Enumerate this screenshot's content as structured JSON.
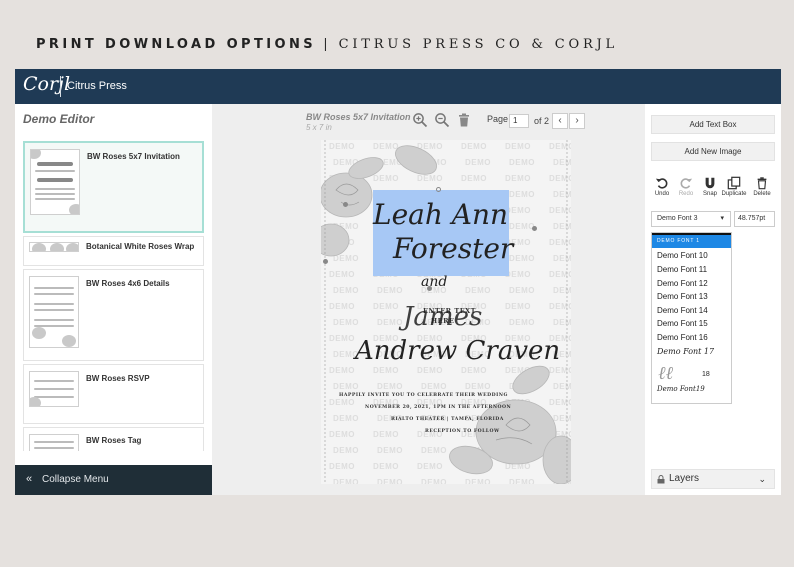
{
  "banner": {
    "part1": "PRINT DOWNLOAD OPTIONS",
    "sep": "|",
    "part2": "CITRUS PRESS CO & CORJL"
  },
  "header": {
    "logo": "Corjl",
    "brand": "Citrus Press"
  },
  "sidebar": {
    "title": "Demo Editor",
    "items": [
      {
        "label": "BW Roses 5x7 Invitation",
        "selected": true
      },
      {
        "label": "Botanical White Roses Wrap"
      },
      {
        "label": "BW Roses 4x6 Details"
      },
      {
        "label": "BW Roses RSVP"
      },
      {
        "label": "BW Roses Tag"
      }
    ],
    "collapse_icon": "double-chevron-left-icon",
    "collapse_label": "Collapse Menu"
  },
  "canvas": {
    "doc_title": "BW Roses 5x7 Invitation",
    "doc_size": "5 x 7 in",
    "page_label": "Page",
    "page_value": "1",
    "page_of": "of 2",
    "prev_icon": "chevron-left-icon",
    "next_icon": "chevron-right-icon",
    "icons": [
      "zoom-in-icon",
      "zoom-out-icon",
      "trash-icon"
    ]
  },
  "invitation": {
    "watermark": "DEMO",
    "bride_first": "Leah Ann",
    "bride_last": "Forester",
    "and": "and",
    "enter_text": "ENTER TEXT",
    "here": "HERE",
    "groom_first": "James",
    "groom_last": "Andrew Craven",
    "line1": "HAPPILY INVITE YOU TO CELEBRATE THEIR WEDDING",
    "line2": "NOVEMBER 20, 2021, 1PM IN THE AFTERNOON",
    "line3": "RIALTO THEATER | TAMPA, FLORIDA",
    "line4": "RECEPTION TO FOLLOW"
  },
  "right_panel": {
    "add_text_box": "Add Text Box",
    "add_new_image": "Add New Image",
    "tools": [
      {
        "label": "Undo",
        "icon": "undo-icon"
      },
      {
        "label": "Redo",
        "icon": "redo-icon",
        "disabled": true
      },
      {
        "label": "Snap",
        "icon": "magnet-icon"
      },
      {
        "label": "Duplicate",
        "icon": "duplicate-icon"
      },
      {
        "label": "Delete",
        "icon": "trash-icon"
      }
    ],
    "font_value": "Demo Font 3",
    "font_size": "48.757pt",
    "font_options": [
      "DEMO FONT 1",
      "Demo Font 10",
      "Demo Font 11",
      "Demo Font 12",
      "Demo Font 13",
      "Demo Font 14",
      "Demo Font 15",
      "Demo Font 16",
      "Demo Font 17",
      "18",
      "Demo Font19"
    ],
    "layers_label": "Layers",
    "layers_icon": "lock-icon"
  },
  "colors": {
    "header": "#1f3a55",
    "collapse": "#1f2e37",
    "selection": "#a7c8f5",
    "dropdown_active": "#1e88e5",
    "selected_item_border": "#a6dfd5"
  }
}
